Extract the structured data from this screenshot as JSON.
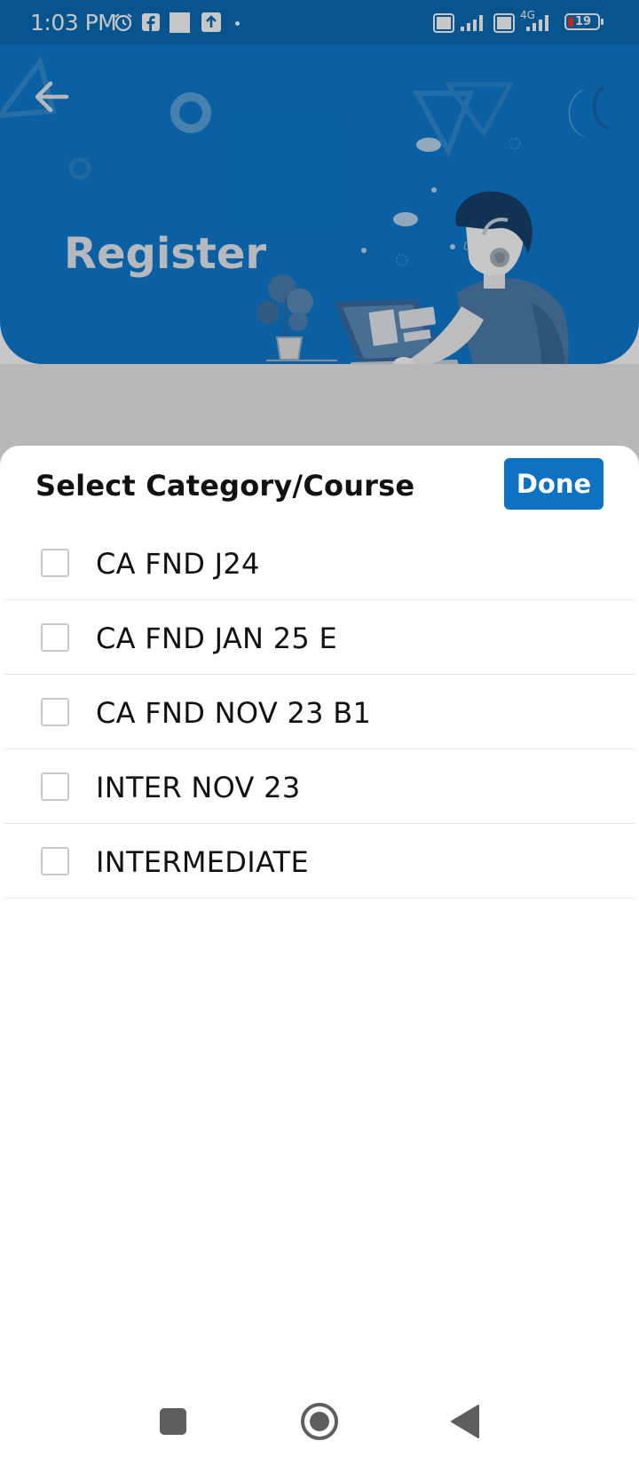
{
  "status_bar": {
    "time": "1:03 PM",
    "battery": "19",
    "icons": [
      "alarm-icon",
      "facebook-icon",
      "square-icon",
      "upload-icon",
      "dot-icon",
      "volte-icon",
      "signal-icon",
      "4g-icon",
      "battery-icon"
    ],
    "network": "4G",
    "volte_label": "Vo LTE"
  },
  "header": {
    "title": "Register",
    "back_icon": "arrow-left-icon",
    "background_color": "#0d7cd0"
  },
  "sheet": {
    "title": "Select Category/Course",
    "done_label": "Done",
    "accent_color": "#0d72c2",
    "items": [
      {
        "label": "CA FND J24",
        "checked": false
      },
      {
        "label": "CA FND JAN 25 E",
        "checked": false
      },
      {
        "label": "CA FND NOV 23 B1",
        "checked": false
      },
      {
        "label": "INTER NOV 23",
        "checked": false
      },
      {
        "label": "INTERMEDIATE",
        "checked": false
      }
    ]
  },
  "nav_bar": {
    "buttons": [
      "recents-icon",
      "home-icon",
      "back-icon"
    ]
  }
}
